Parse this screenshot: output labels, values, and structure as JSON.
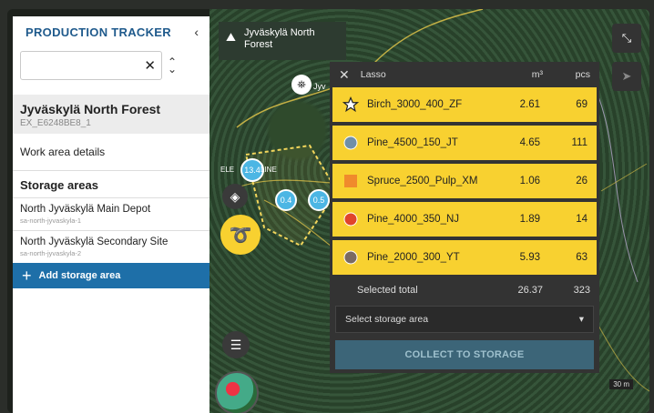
{
  "sidebar": {
    "title": "PRODUCTION TRACKER",
    "search": {
      "value": "",
      "placeholder": ""
    },
    "forest": {
      "name": "Jyväskylä North Forest",
      "id": "EX_E6248BE8_1"
    },
    "work_area_label": "Work area details",
    "storage_heading": "Storage areas",
    "sites": [
      {
        "name": "North Jyväskylä Main Depot",
        "sub": "sa-north-jyvaskyla-1"
      },
      {
        "name": "North Jyväskylä Secondary Site",
        "sub": "sa-north-jyvaskyla-2"
      }
    ],
    "add_label": "Add storage area"
  },
  "map": {
    "location_label": "Jyväskylä North Forest",
    "markers": [
      "13.4",
      "0.4",
      "0.5"
    ],
    "marker_texts": [
      "ELE",
      "LINE",
      "Jyv"
    ],
    "scale": "30 m"
  },
  "lasso": {
    "title": "Lasso",
    "col_volume": "m³",
    "col_count": "pcs",
    "items": [
      {
        "name": "Birch_3000_400_ZF",
        "volume": "2.61",
        "count": "69",
        "symbol": "star",
        "color": "#ffffff"
      },
      {
        "name": "Pine_4500_150_JT",
        "volume": "4.65",
        "count": "111",
        "symbol": "circle",
        "color": "#6f8fa8"
      },
      {
        "name": "Spruce_2500_Pulp_XM",
        "volume": "1.06",
        "count": "26",
        "symbol": "square",
        "color": "#f08a2c"
      },
      {
        "name": "Pine_4000_350_NJ",
        "volume": "1.89",
        "count": "14",
        "symbol": "circle",
        "color": "#e0452b"
      },
      {
        "name": "Pine_2000_300_YT",
        "volume": "5.93",
        "count": "63",
        "symbol": "circle",
        "color": "#7a6b62"
      }
    ],
    "total_label": "Selected total",
    "total_volume": "26.37",
    "total_count": "323",
    "select_label": "Select storage area",
    "collect_label": "COLLECT TO STORAGE"
  },
  "colors": {
    "accent": "#1e6fa8",
    "highlight": "#f8d130",
    "panel": "#333333"
  }
}
